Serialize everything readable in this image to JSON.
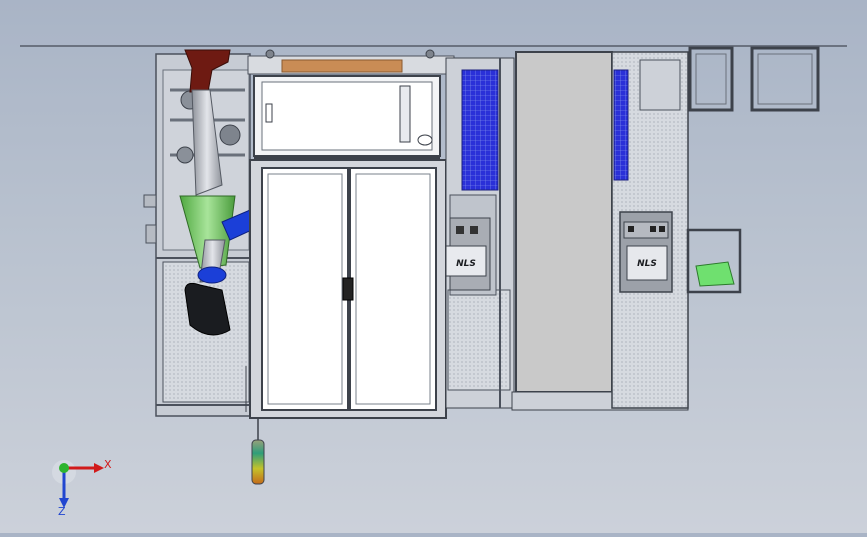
{
  "viewport": {
    "background_top": "#a9b4c6",
    "background_bottom": "#ccd1da"
  },
  "panel_labels": {
    "left_hmi_text": "NLS",
    "right_hmi_text": "NLS"
  },
  "triad": {
    "x_label": "X",
    "z_label": "Z",
    "x_color": "#d11a1a",
    "y_color": "#2fb52f",
    "z_color": "#2146d0"
  },
  "colors": {
    "frame": "#5a6170",
    "hood": "#6e1a12",
    "robot_arm": "#c9ccd2",
    "gripper_cone": "#7fcf6c",
    "blue_part": "#1b3fd8",
    "grid_blue": "#2a2ee0",
    "green_tray": "#6fe06f",
    "tower_light": "#9fbf3c"
  }
}
